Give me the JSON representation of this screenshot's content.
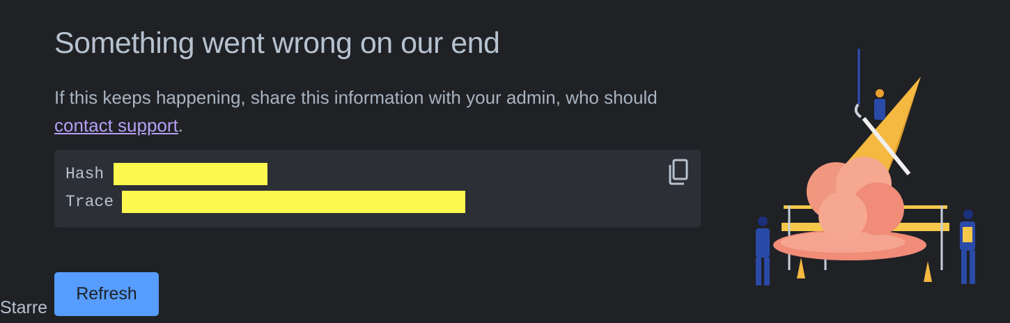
{
  "error": {
    "heading": "Something went wrong on our end",
    "message_prefix": "If this keeps happening, share this information with your admin, who should ",
    "support_link": "contact support",
    "message_suffix": "."
  },
  "details": {
    "hash_label": "Hash",
    "trace_label": "Trace",
    "copy_icon": "copy-icon"
  },
  "actions": {
    "refresh_label": "Refresh"
  },
  "background": {
    "starred_label": "Starre"
  },
  "colors": {
    "background": "#1f2125",
    "code_background": "#2c2f36",
    "link": "#b69ff5",
    "primary_button": "#579dff",
    "redaction": "#fef94e"
  }
}
